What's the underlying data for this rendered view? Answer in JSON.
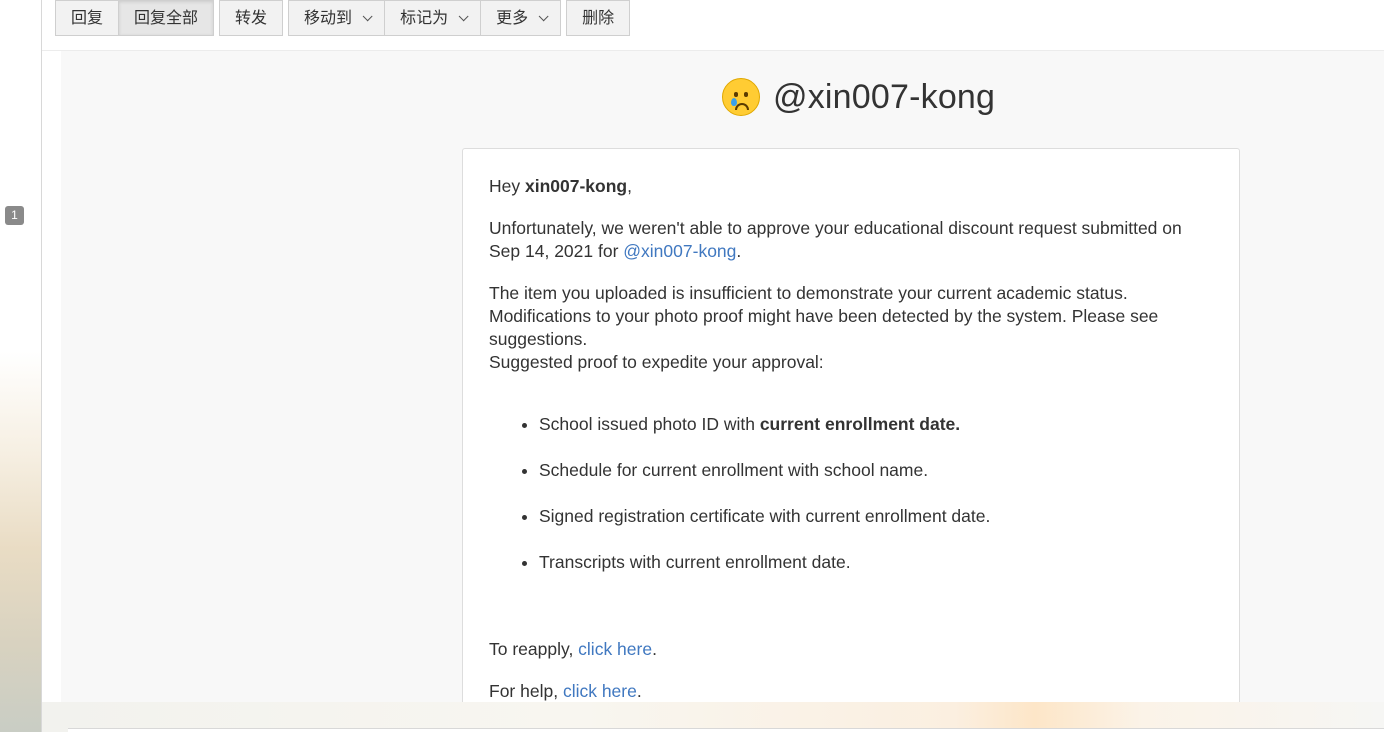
{
  "toolbar": {
    "reply": "回复",
    "reply_all": "回复全部",
    "forward": "转发",
    "move_to": "移动到",
    "mark_as": "标记为",
    "more": "更多",
    "delete": "删除"
  },
  "sidebar": {
    "badge": "1"
  },
  "email": {
    "emoji_icon": "crying-face-icon",
    "hero_title": "@xin007-kong",
    "greeting_prefix": "Hey ",
    "greeting_name": "xin007-kong",
    "greeting_suffix": ",",
    "p1_text": "Unfortunately, we weren't able to approve your educational discount request submitted on Sep 14, 2021 for ",
    "p1_link": "@xin007-kong",
    "p1_end": ".",
    "p2_line1": "The item you uploaded is insufficient to demonstrate your current academic status. Modifications to your photo proof might have been detected by the system. Please see suggestions.",
    "p2_line2": "Suggested proof to expedite your approval:",
    "list_item1_prefix": "School issued photo ID with ",
    "list_item1_bold": "current enrollment date.",
    "list_items": [
      "Schedule for current enrollment with school name.",
      "Signed registration certificate with current enrollment date.",
      "Transcripts with current enrollment date."
    ],
    "reapply_prefix": "To reapply, ",
    "reapply_link": "click here",
    "reapply_end": ".",
    "help_prefix": "For help, ",
    "help_link": "click here",
    "help_end": "."
  }
}
